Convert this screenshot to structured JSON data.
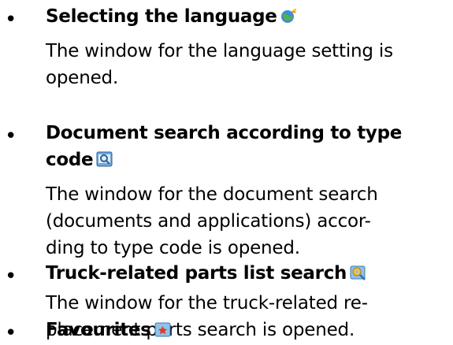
{
  "items": [
    {
      "title": "Selecting the language",
      "icon": "language-globe-icon",
      "description_lines": [
        "The window for the language setting is",
        "opened."
      ]
    },
    {
      "title_lines": [
        "Document search according to type",
        "code"
      ],
      "icon": "document-search-icon",
      "description_lines": [
        "The window for the document search",
        "(documents and applications) accor-",
        "ding to type code is opened."
      ]
    },
    {
      "title": "Truck-related parts list search",
      "icon": "parts-search-icon",
      "description_lines": [
        "The window for the truck-related re-",
        "placement parts search is opened."
      ]
    },
    {
      "title": "Favourites",
      "icon": "favourites-icon"
    }
  ],
  "bullet": "•"
}
